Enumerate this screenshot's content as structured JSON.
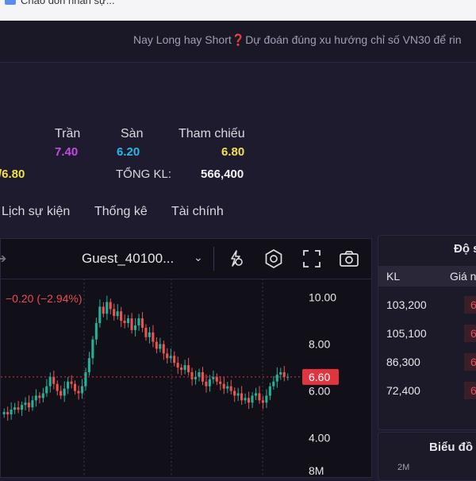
{
  "browser": {
    "tab_text": "Chào đón nhân sự..."
  },
  "banner": {
    "text_before": "Nay Long hay Short",
    "q": "❓",
    "text_after": "Dự đoán đúng xu hướng chỉ số VN30 để rin"
  },
  "stock": {
    "tran_label": "Trần",
    "tran": "7.40",
    "san_label": "Sàn",
    "san": "6.20",
    "tc_label": "Tham chiếu",
    "tc": "6.80",
    "left_val": "/6.80",
    "tongkl_label": "TỔNG KL:",
    "tongkl": "566,400"
  },
  "tabs": [
    "Lịch sự kiện",
    "Thống kê",
    "Tài chính"
  ],
  "chart_toolbar": {
    "title": "Guest_40100...",
    "chev": "⌄"
  },
  "chart_data": {
    "type": "candlestick",
    "change_text": "−0.20 (−2.94%)",
    "y_ticks": [
      "10.00",
      "8.00",
      "6.00",
      "4.00"
    ],
    "y_tick_values": [
      10,
      8,
      6,
      4
    ],
    "last_price_label": "6.60",
    "last_price": 6.6,
    "vol_tick": "8M",
    "ylim": [
      3.0,
      10.8
    ],
    "closes": [
      5.1,
      5.0,
      5.2,
      5.3,
      5.2,
      5.4,
      5.5,
      5.3,
      5.6,
      5.8,
      5.7,
      5.9,
      6.2,
      6.6,
      6.3,
      6.0,
      5.8,
      6.1,
      6.4,
      6.3,
      6.0,
      5.9,
      6.2,
      6.8,
      7.4,
      8.2,
      8.9,
      9.6,
      9.3,
      9.8,
      9.5,
      9.2,
      9.4,
      9.0,
      8.9,
      9.1,
      8.6,
      8.8,
      9.1,
      8.7,
      8.3,
      8.5,
      8.1,
      7.8,
      8.0,
      7.6,
      7.4,
      7.5,
      7.2,
      7.0,
      6.9,
      7.1,
      6.8,
      6.5,
      6.6,
      6.8,
      6.4,
      6.2,
      6.5,
      6.6,
      6.4,
      6.3,
      6.1,
      6.2,
      6.0,
      5.8,
      5.9,
      5.6,
      5.7,
      5.5,
      5.8,
      5.9,
      5.6,
      5.5,
      5.8,
      6.2,
      6.4,
      6.7,
      6.8,
      6.6,
      6.6
    ]
  },
  "order_panel": {
    "head": "Độ s",
    "kl_label": "KL",
    "gia_label": "Giá n",
    "rows": [
      {
        "kl": "103,200",
        "gia": "6"
      },
      {
        "kl": "105,100",
        "gia": "6"
      },
      {
        "kl": "86,300",
        "gia": "6"
      },
      {
        "kl": "72,400",
        "gia": "6"
      }
    ]
  },
  "bieudo": {
    "title": "Biểu đồ",
    "tick": "2M"
  }
}
